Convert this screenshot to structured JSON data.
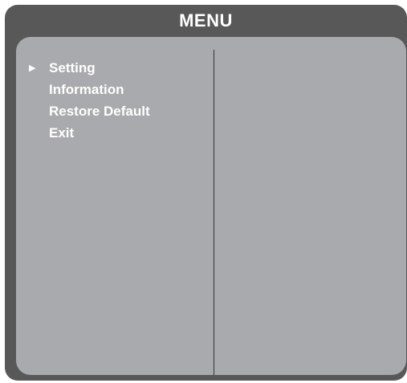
{
  "menu": {
    "title": "MENU",
    "items": [
      {
        "label": "Setting",
        "selected": true
      },
      {
        "label": "Information",
        "selected": false
      },
      {
        "label": "Restore Default",
        "selected": false
      },
      {
        "label": "Exit",
        "selected": false
      }
    ],
    "pointer_icon": "▶"
  },
  "colors": {
    "frame": "#585858",
    "panel": "#a9aaad",
    "text": "#ffffff",
    "divider": "#333333"
  }
}
